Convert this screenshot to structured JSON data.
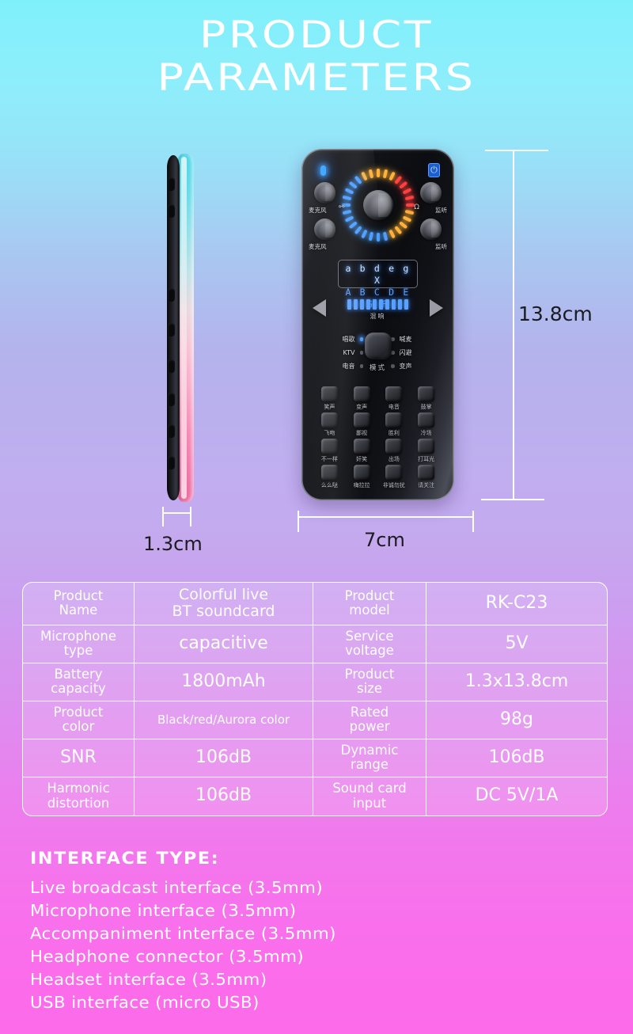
{
  "header": {
    "title_line_1": "PRODUCT",
    "title_line_2": "PARAMETERS"
  },
  "showcase": {
    "device_front": {
      "bluetooth_icon_glyph": "␢",
      "knobs": [
        {
          "label": "麦克风"
        },
        {
          "label": "麦克风"
        },
        {
          "label": "监听"
        },
        {
          "label": "监听"
        }
      ],
      "ring_icon_mic": "🎙",
      "ring_icon_headphone": "Ω",
      "display": {
        "row_1": "a b d e g X",
        "row_2": "A B C D E G F"
      },
      "reverb_label": "混响",
      "mode_button_label": "模式",
      "modes_left": [
        {
          "label": "唱歌",
          "active": true
        },
        {
          "label": "KTV",
          "active": false
        },
        {
          "label": "电音",
          "active": false
        }
      ],
      "modes_right": [
        {
          "label": "喊麦",
          "active": false
        },
        {
          "label": "闪避",
          "active": false
        },
        {
          "label": "变声",
          "active": false
        }
      ],
      "effect_buttons": [
        "笑声",
        "变声",
        "电音",
        "鼓掌",
        "飞吻",
        "鄙视",
        "胜利",
        "冷场",
        "不一样",
        "奸笑",
        "出场",
        "打耳光",
        "么么哒",
        "嗨拉拉",
        "非诚勿扰",
        "请关注"
      ]
    },
    "dimensions": {
      "height": "13.8cm",
      "thickness": "1.3cm",
      "width": "7cm"
    }
  },
  "spec_table": {
    "rows": [
      {
        "key_a": "Product\nName",
        "val_a": "Colorful live\nBT soundcard",
        "val_a_size": "v-md",
        "key_b": "Product\nmodel",
        "val_b": "RK-C23",
        "val_b_size": "v-lg"
      },
      {
        "key_a": "Microphone\ntype",
        "val_a": "capacitive",
        "val_a_size": "v-lg",
        "key_b": "Service\nvoltage",
        "val_b": "5V",
        "val_b_size": "v-lg"
      },
      {
        "key_a": "Battery\ncapacity",
        "val_a": "1800mAh",
        "val_a_size": "v-lg",
        "key_b": "Product\nsize",
        "val_b": "1.3x13.8cm",
        "val_b_size": "v-lg"
      },
      {
        "key_a": "Product\ncolor",
        "val_a": "Black/red/Aurora color",
        "val_a_size": "v-sm",
        "key_b": "Rated\npower",
        "val_b": "98g",
        "val_b_size": "v-lg"
      },
      {
        "key_a": "SNR",
        "val_a": "106dB",
        "val_a_size": "v-lg",
        "key_b": "Dynamic\nrange",
        "val_b": "106dB",
        "val_b_size": "v-lg"
      },
      {
        "key_a": "Harmonic\ndistortion",
        "val_a": "106dB",
        "val_a_size": "v-lg",
        "key_b": "Sound card\ninput",
        "val_b": "DC 5V/1A",
        "val_b_size": "v-lg"
      }
    ]
  },
  "interface_section": {
    "heading": "INTERFACE TYPE:",
    "items": [
      "Live broadcast interface (3.5mm)",
      "Microphone interface (3.5mm)",
      "Accompaniment interface (3.5mm)",
      "Headphone connector (3.5mm)",
      "Headset interface (3.5mm)",
      "USB interface (micro USB)"
    ]
  },
  "colors": {
    "background_top": "#7ff0fb",
    "background_bottom": "#fd6aea",
    "table_border": "#ffffff",
    "text_on_gradient": "#ffffff",
    "dimension_text": "#1b1b20",
    "led_blue": "#4a9dff",
    "led_yellow": "#ffb23a",
    "led_red": "#ff4040"
  }
}
